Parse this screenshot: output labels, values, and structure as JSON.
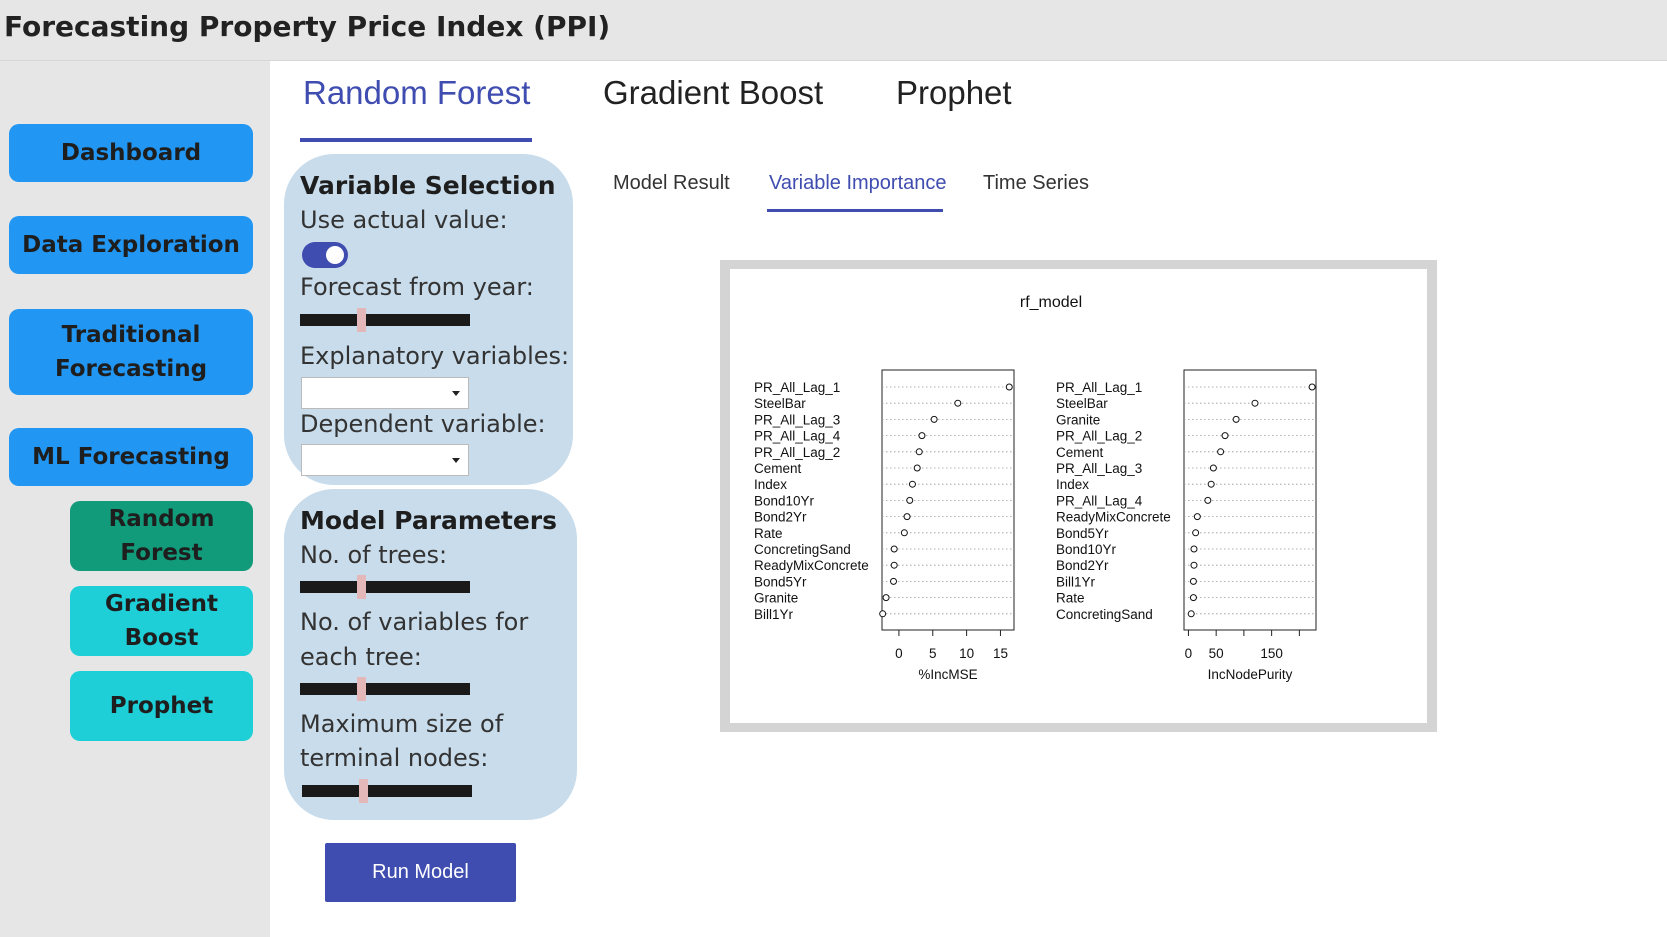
{
  "app": {
    "title": "Forecasting Property Price Index (PPI)"
  },
  "sidebar": {
    "dashboard": "Dashboard",
    "data_exploration": "Data Exploration",
    "traditional_forecasting": "Traditional Forecasting",
    "ml_forecasting": "ML Forecasting",
    "random_forest": "Random Forest",
    "gradient_boost": "Gradient Boost",
    "prophet": "Prophet"
  },
  "top_tabs": [
    "Random Forest",
    "Gradient Boost",
    "Prophet"
  ],
  "variable_selection": {
    "header": "Variable Selection",
    "use_actual_label": "Use actual value:",
    "use_actual_on": true,
    "forecast_year_label": "Forecast from year:",
    "forecast_year_level": 0.36,
    "explanatory_label": "Explanatory variables:",
    "dependent_label": "Dependent variable:"
  },
  "model_parameters": {
    "header": "Model Parameters",
    "trees_label": "No. of trees:",
    "trees_level": 0.36,
    "vars_label_1": "No. of variables for",
    "vars_label_2": "each tree:",
    "vars_level": 0.36,
    "nodes_label_1": "Maximum size of",
    "nodes_label_2": "terminal nodes:",
    "nodes_level": 0.36
  },
  "run_button": "Run Model",
  "sub_tabs": [
    "Model Result",
    "Variable Importance",
    "Time Series"
  ],
  "colors": {
    "accent": "#3f4cb0",
    "nav_blue": "#2196f3",
    "nav_green": "#129b7a",
    "nav_cyan": "#1ecfd8"
  },
  "chart_data": {
    "type": "scatter",
    "title": "rf_model",
    "panels": [
      {
        "xlabel": "%IncMSE",
        "ticks": [
          0,
          5,
          10,
          15
        ],
        "xlim": [
          -2.5,
          17
        ],
        "labels": [
          "PR_All_Lag_1",
          "SteelBar",
          "PR_All_Lag_3",
          "PR_All_Lag_4",
          "PR_All_Lag_2",
          "Cement",
          "Index",
          "Bond10Yr",
          "Bond2Yr",
          "Rate",
          "ConcretingSand",
          "ReadyMixConcrete",
          "Bond5Yr",
          "Granite",
          "Bill1Yr"
        ],
        "values": [
          16.3,
          8.7,
          5.2,
          3.4,
          3.0,
          2.7,
          2.0,
          1.6,
          1.2,
          0.8,
          -0.7,
          -0.7,
          -0.8,
          -1.9,
          -2.4
        ]
      },
      {
        "xlabel": "IncNodePurity",
        "ticks": [
          0,
          50,
          150
        ],
        "xlim": [
          -8,
          230
        ],
        "labels": [
          "PR_All_Lag_1",
          "SteelBar",
          "Granite",
          "PR_All_Lag_2",
          "Cement",
          "PR_All_Lag_3",
          "Index",
          "PR_All_Lag_4",
          "ReadyMixConcrete",
          "Bond5Yr",
          "Bond10Yr",
          "Bond2Yr",
          "Bill1Yr",
          "Rate",
          "ConcretingSand"
        ],
        "values": [
          223,
          120,
          86,
          66,
          58,
          45,
          41,
          35,
          16,
          13,
          10,
          10,
          9,
          9,
          5
        ]
      }
    ]
  }
}
